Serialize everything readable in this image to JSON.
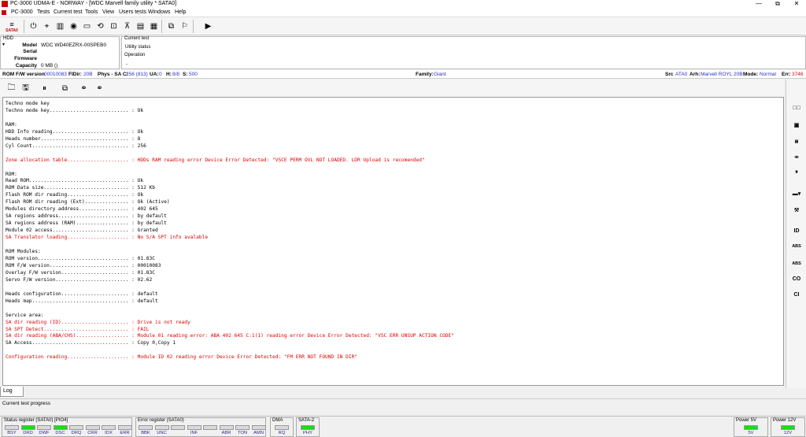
{
  "window": {
    "title": "PC-3000 UDMA-E - NORWAY - [WDC Marvell family utility * SATA0]",
    "controls": {
      "minimize": "—",
      "restore": "⧉",
      "close": "✕"
    }
  },
  "menu": [
    "PC-3000",
    "Tests",
    "Current test",
    "Tools",
    "View",
    "Users tests",
    "Windows",
    "Help"
  ],
  "toolbar": {
    "sata_label": "SATA0"
  },
  "hdd": {
    "section_label": "HDD",
    "model_label": "Model",
    "model_value": "WDC WD40EZRX-00SPEB0",
    "serial_label": "Serial",
    "serial_value": "",
    "firmware_label": "Firmware",
    "firmware_value": "",
    "capacity_label": "Capacity",
    "capacity_value": "0 MB ()"
  },
  "current_test": {
    "label": "Current test",
    "value": "Utility status",
    "operation_label": "Operation",
    "operation_value": "-"
  },
  "infobar": {
    "rom_label": "ROM F/W version",
    "rom_value": "00010083",
    "fidir_label": "FIDir:",
    "fidir_value": "20B",
    "phys_label": "Phys - SA C:",
    "phys_value": "256 (813)",
    "ua_label": "UA:",
    "ua_value": "0",
    "h_label": "H:",
    "h_value": "8/8",
    "s_label": "S:",
    "s_value": "500",
    "family_label": "Family:",
    "family_value": "Giant",
    "src_label": "Src",
    "src_value": "ATA0",
    "arh_label": "Arh:",
    "arh_value": "Marvell ROYL 20B",
    "mode_label": "Mode:",
    "mode_value": "Normal",
    "err_label": "Err:",
    "err_value": "3746"
  },
  "log_lines": [
    {
      "text": "Techno mode key",
      "error": false
    },
    {
      "text": "Techno mode key........................... : Ok",
      "error": false
    },
    {
      "text": "",
      "error": false
    },
    {
      "text": "RAM:",
      "error": false
    },
    {
      "text": "HDD Info reading.......................... : Ok",
      "error": false
    },
    {
      "text": "Heads number.............................. : 8",
      "error": false
    },
    {
      "text": "Cyl Count................................. : 256",
      "error": false
    },
    {
      "text": "",
      "error": false
    },
    {
      "text": "Zone allocation table..................... : HDDs RAM reading error Device Error Detected: \"VSCE PERM OVL NOT LOADED. LDR Upload is recomended\"",
      "error": true
    },
    {
      "text": "",
      "error": false
    },
    {
      "text": "ROM:",
      "error": false
    },
    {
      "text": "Read ROM.................................. : Ok",
      "error": false
    },
    {
      "text": "ROM Data size............................. : 512 Kb",
      "error": false
    },
    {
      "text": "Flash ROM dir reading..................... : Ok",
      "error": false
    },
    {
      "text": "Flash ROM dir reading (Ext)............... : Ok (Active)",
      "error": false
    },
    {
      "text": "Modules directory address................. : 402 645",
      "error": false
    },
    {
      "text": "SA regions address........................ : by default",
      "error": false
    },
    {
      "text": "SA regions address (RAM).................. : by default",
      "error": false
    },
    {
      "text": "Module 02 access.......................... : Granted",
      "error": false
    },
    {
      "text": "SA Translator loading..................... : No S/A SPT info avalable",
      "error": true
    },
    {
      "text": "",
      "error": false
    },
    {
      "text": "ROM Modules:",
      "error": false
    },
    {
      "text": "ROM version............................... : 01.83C",
      "error": false
    },
    {
      "text": "ROM F/W version........................... : 00010083",
      "error": false
    },
    {
      "text": "Overlay F/W version....................... : 01.83C",
      "error": false
    },
    {
      "text": "Servo F/W version......................... : 02.62",
      "error": false
    },
    {
      "text": "",
      "error": false
    },
    {
      "text": "Heads configuration....................... : default",
      "error": false
    },
    {
      "text": "Heads map................................. : default",
      "error": false
    },
    {
      "text": "",
      "error": false
    },
    {
      "text": "Service area:",
      "error": false
    },
    {
      "text": "SA dir reading (ID)....................... : Drive is not ready",
      "error": true
    },
    {
      "text": "SA SPT Detect............................. : FAIL",
      "error": true
    },
    {
      "text": "SA dir reading (ABA/CHS).................. : Module 01 reading error: ABA 402 645 C:1(1) reading error Device Error Detected: \"VSC ERR UNSUP ACTION CODE\"",
      "error": true
    },
    {
      "text": "SA Access................................. : Copy 0,Copy 1",
      "error": false
    },
    {
      "text": "",
      "error": false
    },
    {
      "text": "Configuration reading..................... : Module ID 02 reading error Device Error Detected: \"FM ERR NOT FOUND IN DIR\"",
      "error": true
    }
  ],
  "right_toolbar": {
    "id": "ID",
    "abs": "ABS",
    "abs2": "ABS",
    "co": "CO",
    "ci": "CI"
  },
  "log_tab": "Log",
  "progress_label": "Current test progress",
  "status": {
    "status_reg_title": "Status register (SATA0) [PIO4]",
    "status_leds": [
      {
        "label": "BSY",
        "on": false
      },
      {
        "label": "DRD",
        "on": true
      },
      {
        "label": "DWF",
        "on": false
      },
      {
        "label": "DSC",
        "on": true
      },
      {
        "label": "DRQ",
        "on": false
      },
      {
        "label": "CRR",
        "on": false
      },
      {
        "label": "IDX",
        "on": false
      },
      {
        "label": "ERR",
        "on": false
      }
    ],
    "error_reg_title": "Error register (SATA0)",
    "error_leds": [
      {
        "label": "BBK",
        "on": false
      },
      {
        "label": "UNC",
        "on": false
      },
      {
        "label": "",
        "on": false
      },
      {
        "label": "INF",
        "on": false
      },
      {
        "label": "",
        "on": false
      },
      {
        "label": "ABR",
        "on": false
      },
      {
        "label": "TON",
        "on": false
      },
      {
        "label": "AMN",
        "on": false
      }
    ],
    "dma_title": "DMA",
    "dma_led": {
      "label": "RQ",
      "on": false
    },
    "sata_title": "SATA-2",
    "sata_led": {
      "label": "PHY",
      "on": true
    },
    "power5_title": "Power 5V",
    "power5_led": {
      "label": "5V",
      "on": true
    },
    "power12_title": "Power 12V",
    "power12_led": {
      "label": "12V",
      "on": true
    }
  },
  "colors": {
    "led_on": "#1fd81f",
    "error_text": "#e00000",
    "value_blue": "#2d2dc8"
  }
}
